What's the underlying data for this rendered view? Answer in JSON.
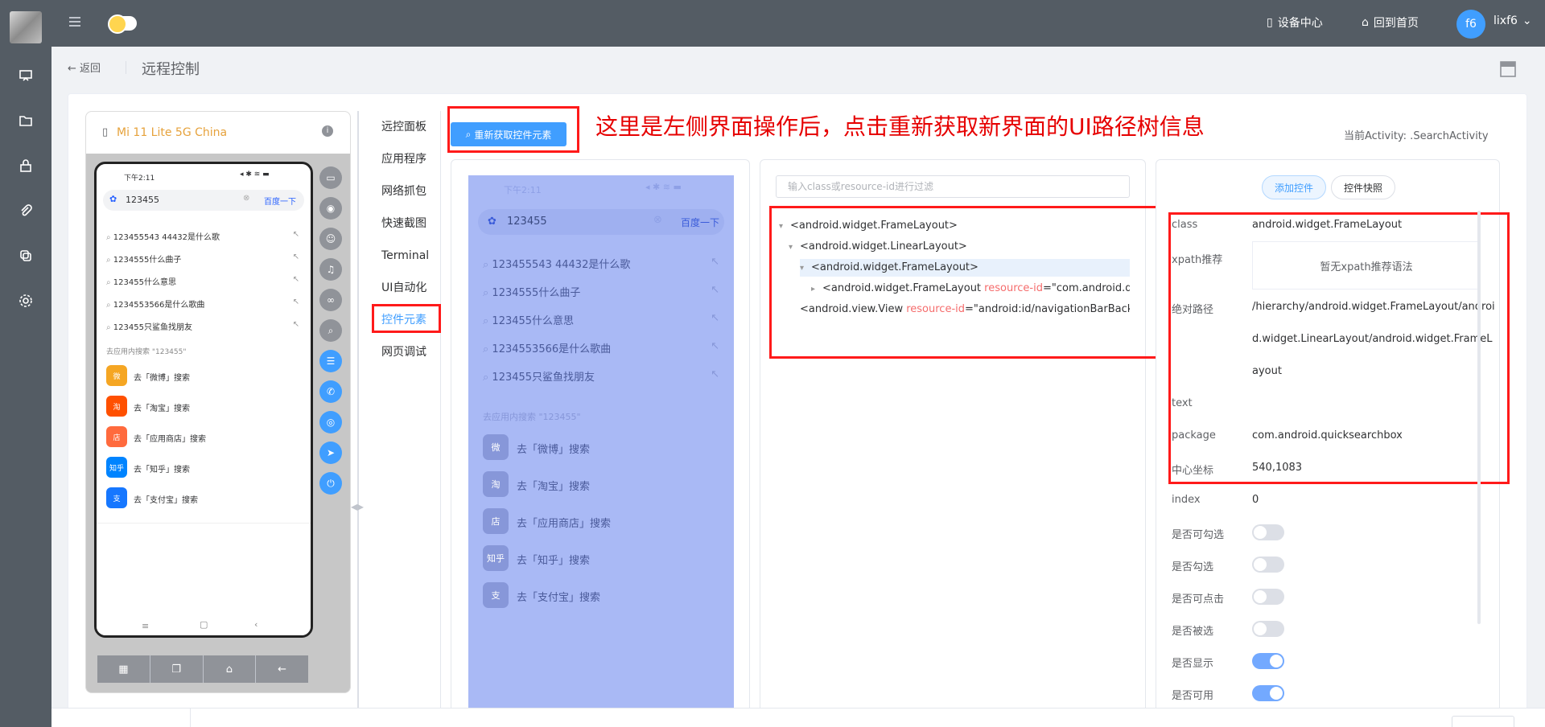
{
  "header": {
    "device_center": "设备中心",
    "home": "回到首页",
    "avatar": "f6",
    "user": "lixf6"
  },
  "page": {
    "back": "返回",
    "title": "远程控制"
  },
  "device": {
    "name": "Mi 11 Lite 5G China",
    "info_icon": "i"
  },
  "phone": {
    "status_time": "下午2:11",
    "search_query": "123455",
    "search_button": "百度一下",
    "suggestions": [
      "123455543 44432是什么歌",
      "1234555什么曲子",
      "123455什么意思",
      "1234553566是什么歌曲",
      "123455只鲨鱼找朋友"
    ],
    "in_app_label": "去应用内搜索 \"123455\"",
    "apps": [
      {
        "icon": "微",
        "color": "#f5a623",
        "label": "去「微博」搜索"
      },
      {
        "icon": "淘",
        "color": "#ff5000",
        "label": "去「淘宝」搜索"
      },
      {
        "icon": "店",
        "color": "#ff6a3d",
        "label": "去「应用商店」搜索"
      },
      {
        "icon": "知乎",
        "color": "#0084ff",
        "label": "去「知乎」搜索"
      },
      {
        "icon": "支",
        "color": "#1677ff",
        "label": "去「支付宝」搜索"
      }
    ]
  },
  "mirror": {
    "in_app_label": "去应用内搜索 \"123455\"",
    "apps": [
      {
        "icon": "微",
        "label": "去「微博」搜索"
      },
      {
        "icon": "淘",
        "label": "去「淘宝」搜索"
      },
      {
        "icon": "店",
        "label": "去「应用商店」搜索"
      },
      {
        "icon": "知乎",
        "label": "去「知乎」搜索"
      },
      {
        "icon": "支",
        "label": "去「支付宝」搜索"
      }
    ]
  },
  "tabs": [
    "远控面板",
    "应用程序",
    "网络抓包",
    "快速截图",
    "Terminal",
    "UI自动化",
    "控件元素",
    "网页调试"
  ],
  "toolbar": {
    "refresh": "重新获取控件元素",
    "annotation": "这里是左侧界面操作后，点击重新获取新界面的UI路径树信息",
    "activity": "当前Activity:   .SearchActivity"
  },
  "tree": {
    "filter_placeholder": "输入class或resource-id进行过滤",
    "nodes": [
      {
        "text": "<android.widget.FrameLayout>"
      },
      {
        "text": "<android.widget.LinearLayout>"
      },
      {
        "text": "<android.widget.FrameLayout>"
      },
      {
        "text": "<android.widget.FrameLayout ",
        "attr": "resource-id",
        "rest": "=\"com.android.quic"
      },
      {
        "text": "<android.view.View ",
        "attr": "resource-id",
        "rest": "=\"android:id/navigationBarBackgr"
      }
    ]
  },
  "props": {
    "add_button": "添加控件",
    "snapshot_button": "控件快照",
    "class_label": "class",
    "class_value": "android.widget.FrameLayout",
    "xpath_label": "xpath推荐",
    "xpath_value": "暂无xpath推荐语法",
    "abs_label": "绝对路径",
    "abs_line1": "/hierarchy/android.widget.FrameLayout/androi",
    "abs_line2": "d.widget.LinearLayout/android.widget.FrameL",
    "abs_line3": "ayout",
    "text_label": "text",
    "package_label": "package",
    "package_value": "com.android.quicksearchbox",
    "center_label": "中心坐标",
    "center_value": "540,1083",
    "index_label": "index",
    "index_value": "0",
    "checkable": "是否可勾选",
    "checked": "是否勾选",
    "clickable": "是否可点击",
    "selected": "是否被选",
    "displayed": "是否显示",
    "enabled": "是否可用"
  }
}
